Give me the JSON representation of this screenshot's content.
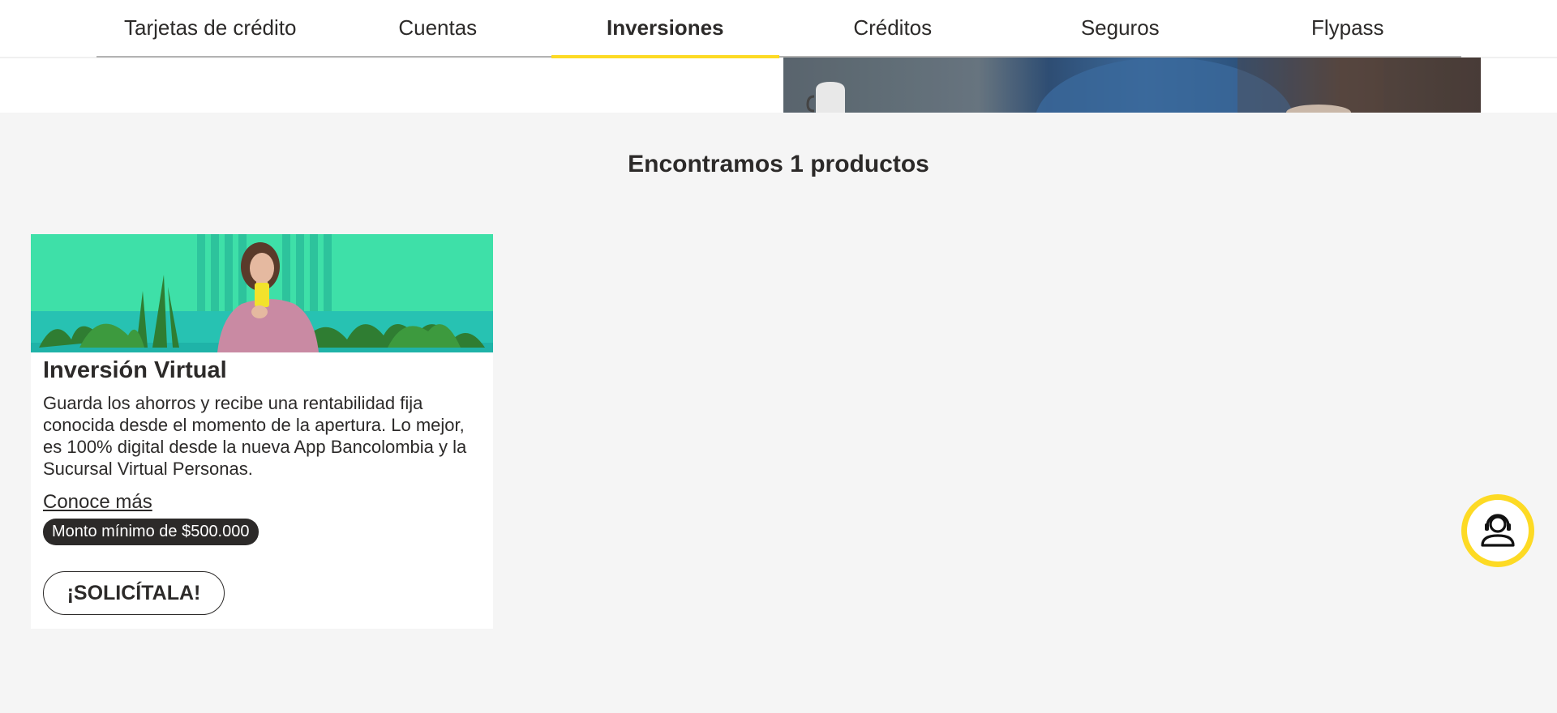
{
  "nav": {
    "tabs": [
      {
        "label": "Tarjetas de crédito"
      },
      {
        "label": "Cuentas"
      },
      {
        "label": "Inversiones",
        "active": true
      },
      {
        "label": "Créditos"
      },
      {
        "label": "Seguros"
      },
      {
        "label": "Flypass"
      }
    ]
  },
  "results": {
    "title": "Encontramos 1 productos"
  },
  "product": {
    "title": "Inversión Virtual",
    "description": "Guarda los ahorros y recibe una rentabilidad fija conocida desde el momento de la apertura. Lo mejor, es 100% digital desde la nueva App Bancolombia y la Sucursal Virtual Personas.",
    "link_label": "Conoce más",
    "badge": "Monto mínimo de $500.000",
    "button_label": "¡SOLICÍTALA!"
  },
  "chat": {
    "icon": "support-agent-icon"
  },
  "colors": {
    "accent": "#fdda24",
    "text": "#2c2a29",
    "background": "#f5f5f5"
  }
}
